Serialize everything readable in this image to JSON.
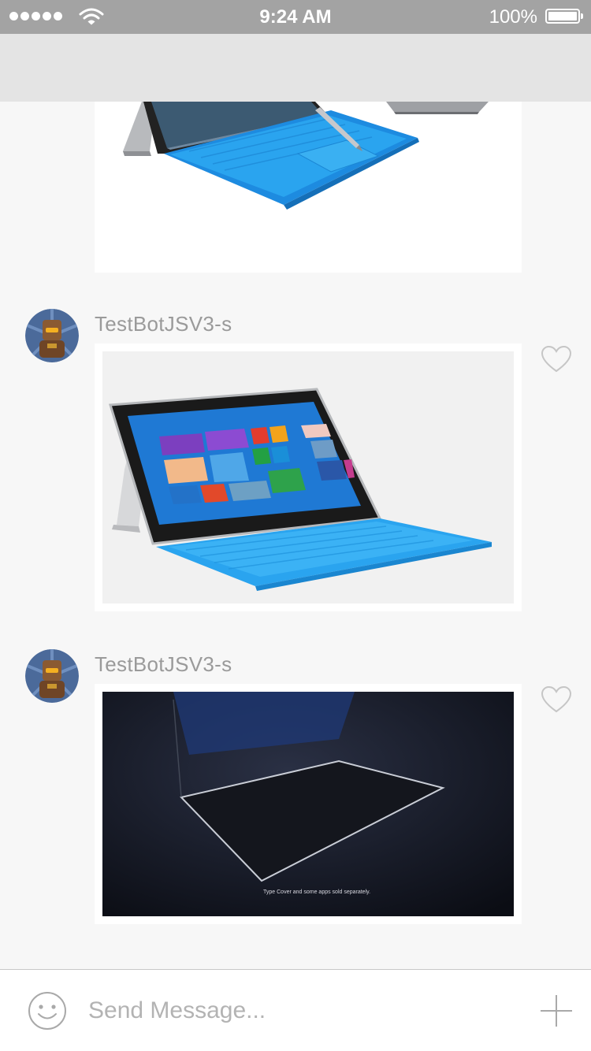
{
  "status_bar": {
    "time": "9:24 AM",
    "battery": "100%"
  },
  "messages": [
    {
      "sender": "TestBotJSV3-s",
      "image": "surface-tablet-with-blue-keyboard"
    },
    {
      "sender": "TestBotJSV3-s",
      "image": "surface-tablet-in-dark",
      "caption": "Type Cover and some apps sold separately."
    }
  ],
  "composer": {
    "placeholder": "Send Message..."
  },
  "icons": {
    "emoji": "smiley-icon",
    "add": "plus-icon",
    "like": "heart-icon"
  },
  "colors": {
    "status_bar_bg": "#a3a3a3",
    "nav_bar_bg": "#e4e4e4",
    "feed_bg": "#f7f7f7",
    "keyboard_blue": "#2aa4ef"
  }
}
